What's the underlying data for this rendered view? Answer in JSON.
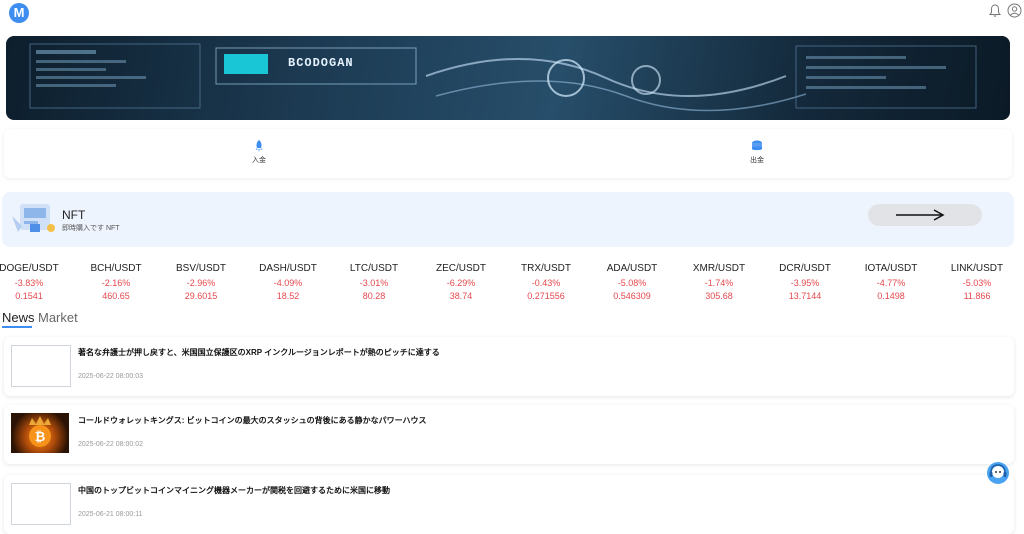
{
  "header": {
    "logo_letter": "M",
    "icons": [
      "bell-icon",
      "user-icon"
    ]
  },
  "banner": {
    "brand_text": "BCODOGAN"
  },
  "actions": [
    {
      "label": "入金",
      "icon": "rocket-icon"
    },
    {
      "label": "出金",
      "icon": "coin-stack-icon"
    }
  ],
  "nft": {
    "title": "NFT",
    "subtitle": "即時購入です NFT"
  },
  "tickers": [
    {
      "pair": "DOGE/USDT",
      "change": "-3.83%",
      "price": "0.1541"
    },
    {
      "pair": "BCH/USDT",
      "change": "-2.16%",
      "price": "460.65"
    },
    {
      "pair": "BSV/USDT",
      "change": "-2.96%",
      "price": "29.6015"
    },
    {
      "pair": "DASH/USDT",
      "change": "-4.09%",
      "price": "18.52"
    },
    {
      "pair": "LTC/USDT",
      "change": "-3.01%",
      "price": "80.28"
    },
    {
      "pair": "ZEC/USDT",
      "change": "-6.29%",
      "price": "38.74"
    },
    {
      "pair": "TRX/USDT",
      "change": "-0.43%",
      "price": "0.271556"
    },
    {
      "pair": "ADA/USDT",
      "change": "-5.08%",
      "price": "0.546309"
    },
    {
      "pair": "XMR/USDT",
      "change": "-1.74%",
      "price": "305.68"
    },
    {
      "pair": "DCR/USDT",
      "change": "-3.95%",
      "price": "13.7144"
    },
    {
      "pair": "IOTA/USDT",
      "change": "-4.77%",
      "price": "0.1498"
    },
    {
      "pair": "LINK/USDT",
      "change": "-5.03%",
      "price": "11.866"
    }
  ],
  "tabs": {
    "news": "News",
    "market": "Market",
    "active": "News"
  },
  "news": [
    {
      "headline": "著名な弁護士が押し戻すと、米国国立保護区のXRP インクルージョンレポートが熱のピッチに達する",
      "date": "2025-06-22 08:00:03"
    },
    {
      "headline": "コールドウォレットキングス: ビットコインの最大のスタッシュの背後にある静かなパワーハウス",
      "date": "2025-06-22 08:00:02"
    },
    {
      "headline": "中国のトップビットコインマイニング機器メーカーが関税を回避するために米国に移動",
      "date": "2025-06-21 08:00:11"
    }
  ],
  "colors": {
    "accent": "#3d8ef0",
    "negative": "#e5484d"
  }
}
